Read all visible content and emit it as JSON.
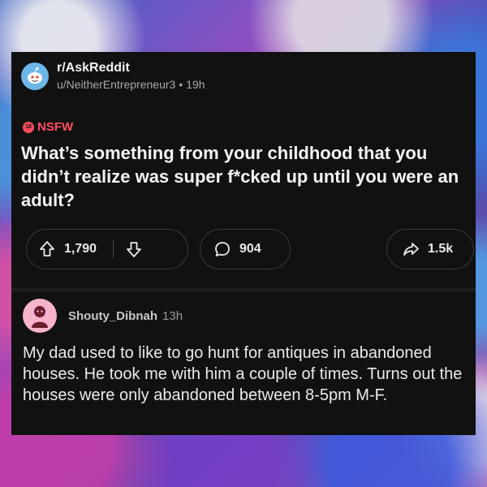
{
  "post": {
    "subreddit": "r/AskReddit",
    "author": "u/NeitherEntrepreneur3",
    "separator": "•",
    "age": "19h",
    "nsfw_badge": "18",
    "nsfw_label": "NSFW",
    "title": "What’s something from your childhood that you didn’t realize was super f*cked up until you were an adult?",
    "upvotes": "1,790",
    "comments": "904",
    "shares": "1.5k"
  },
  "comment": {
    "username": "Shouty_Dibnah",
    "age": "13h",
    "body": "My dad used to like to go hunt for antiques in abandoned houses.  He took me with him a couple of times.  Turns out the houses were only abandoned between 8-5pm M-F."
  },
  "colors": {
    "card_bg": "#111111",
    "nsfw": "#ff4b5c",
    "subreddit_avatar": "#6fb6e8",
    "user_avatar": "#f7b3cc"
  },
  "icons": [
    "reddit-snoo-icon",
    "upvote-arrow-icon",
    "downvote-arrow-icon",
    "comment-bubble-icon",
    "share-arrow-icon",
    "user-snoo-icon"
  ]
}
